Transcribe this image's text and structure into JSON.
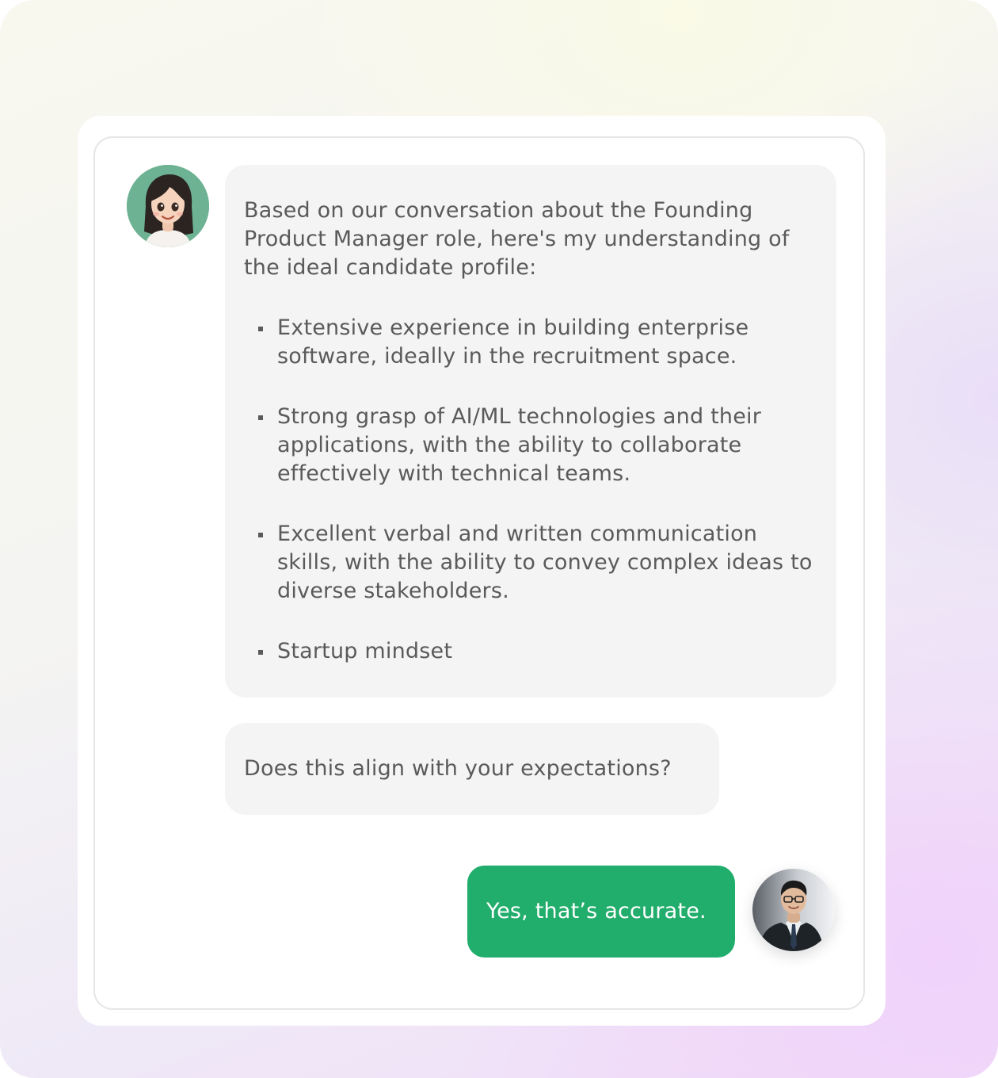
{
  "chat": {
    "bot_avatar": {
      "icon": "cartoon-woman-avatar",
      "background_color": "#6db293"
    },
    "user_avatar": {
      "icon": "man-in-suit-avatar"
    },
    "messages": {
      "summary": {
        "intro": "Based on our conversation about the Founding Product Manager role, here's my understanding of the ideal candidate profile:",
        "bullets": [
          "Extensive experience in building enterprise software, ideally in the recruitment space.",
          "Strong grasp of AI/ML technologies and their applications, with the ability to collaborate effectively with technical teams.",
          "Excellent verbal and written communication skills, with the ability to convey complex ideas to diverse stakeholders.",
          "Startup mindset"
        ]
      },
      "question": "Does this align with your expectations?",
      "reply": "Yes, that’s accurate."
    }
  },
  "colors": {
    "reply_bubble": "#21ad6b",
    "bot_bubble": "#f4f4f4",
    "text": "#5a5a5a"
  }
}
